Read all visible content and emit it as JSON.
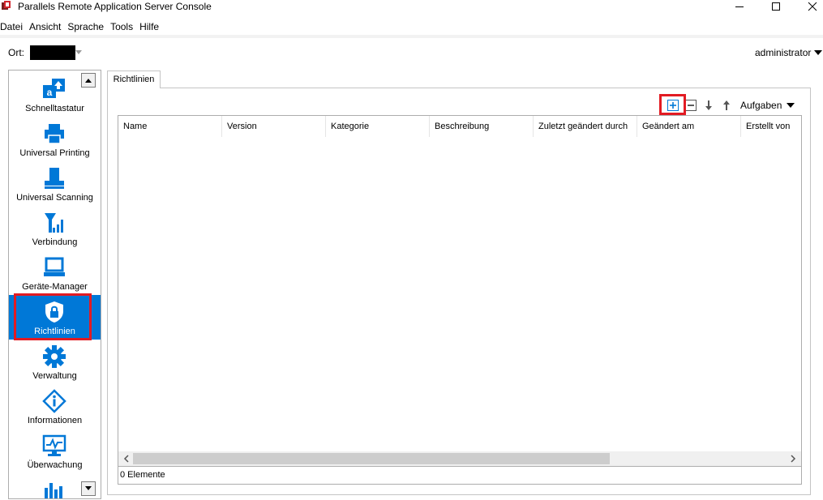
{
  "window": {
    "title": "Parallels Remote Application Server Console",
    "icons": {
      "app": "parallels-app-icon",
      "minimize": "minimize-icon",
      "maximize": "maximize-icon",
      "close": "close-icon"
    }
  },
  "menu": {
    "items": [
      "Datei",
      "Ansicht",
      "Sprache",
      "Tools",
      "Hilfe"
    ]
  },
  "location": {
    "label": "Ort:",
    "value": ""
  },
  "user": {
    "name": "administrator"
  },
  "sidebar": {
    "items": [
      {
        "label": "Schnelltastatur",
        "icon": "keyboard-shortcut-icon"
      },
      {
        "label": "Universal Printing",
        "icon": "printer-icon"
      },
      {
        "label": "Universal Scanning",
        "icon": "scanner-icon"
      },
      {
        "label": "Verbindung",
        "icon": "antenna-signal-icon"
      },
      {
        "label": "Geräte-Manager",
        "icon": "laptop-icon"
      },
      {
        "label": "Richtlinien",
        "icon": "shield-lock-icon",
        "selected": true
      },
      {
        "label": "Verwaltung",
        "icon": "gear-icon"
      },
      {
        "label": "Informationen",
        "icon": "info-icon"
      },
      {
        "label": "Überwachung",
        "icon": "monitor-chart-icon"
      },
      {
        "label": "",
        "icon": "bar-chart-icon"
      }
    ]
  },
  "tab": {
    "label": "Richtlinien"
  },
  "toolbar": {
    "add_icon": "add-icon",
    "remove_icon": "remove-icon",
    "down_icon": "arrow-down-icon",
    "up_icon": "arrow-up-icon",
    "tasks_label": "Aufgaben"
  },
  "table": {
    "columns": [
      "Name",
      "Version",
      "Kategorie",
      "Beschreibung",
      "Zuletzt geändert durch",
      "Geändert am",
      "Erstellt von"
    ],
    "rows": [],
    "status": "0 Elemente"
  },
  "colors": {
    "selected": "#0078d7",
    "highlight": "#e21b23",
    "icon_blue": "#0078d7"
  }
}
